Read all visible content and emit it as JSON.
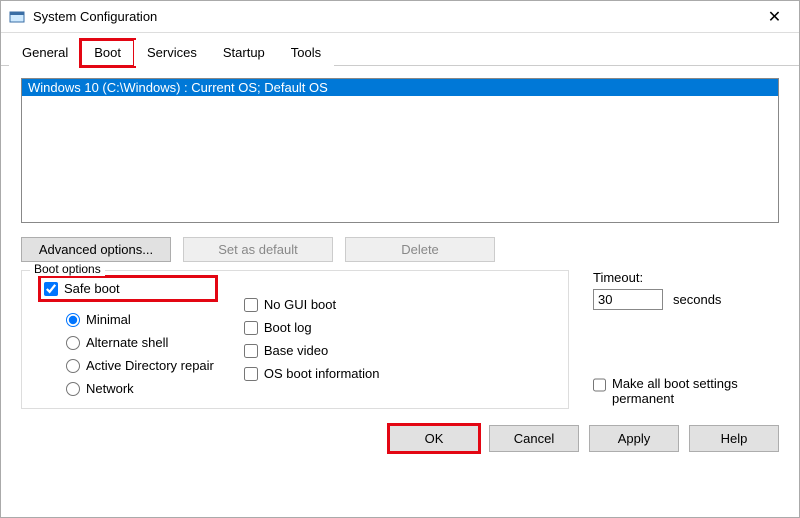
{
  "window": {
    "title": "System Configuration",
    "close": "✕"
  },
  "tabs": {
    "general": "General",
    "boot": "Boot",
    "services": "Services",
    "startup": "Startup",
    "tools": "Tools"
  },
  "bootlist": {
    "item0": "Windows 10 (C:\\Windows) : Current OS; Default OS"
  },
  "buttons": {
    "advanced": "Advanced options...",
    "setdefault": "Set as default",
    "delete": "Delete"
  },
  "bootoptions": {
    "title": "Boot options",
    "safeboot": "Safe boot",
    "minimal": "Minimal",
    "altshell": "Alternate shell",
    "adrepair": "Active Directory repair",
    "network": "Network",
    "nogui": "No GUI boot",
    "bootlog": "Boot log",
    "basevideo": "Base video",
    "osinfo": "OS boot information"
  },
  "timeout": {
    "label": "Timeout:",
    "value": "30",
    "unit": "seconds",
    "permanent": "Make all boot settings permanent"
  },
  "footer": {
    "ok": "OK",
    "cancel": "Cancel",
    "apply": "Apply",
    "help": "Help"
  }
}
